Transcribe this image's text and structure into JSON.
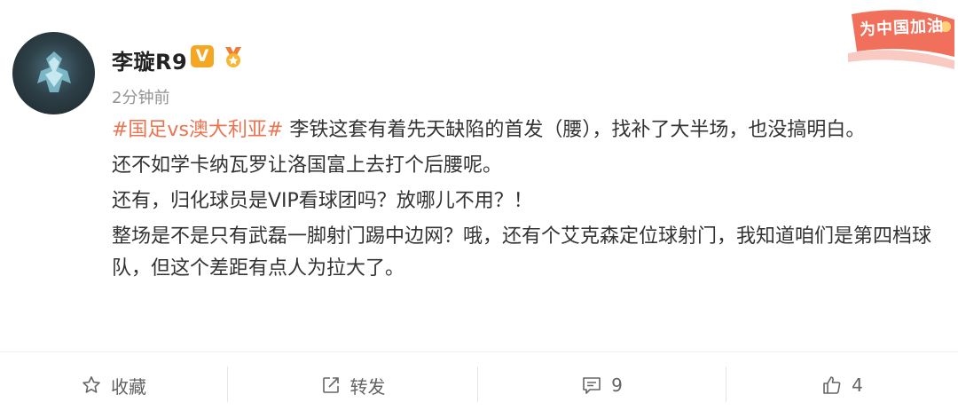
{
  "user": {
    "name": "李璇R9",
    "verified_badge": "V",
    "timestamp": "2分钟前"
  },
  "decoration": {
    "text": "为中国加油"
  },
  "post": {
    "hashtag": "#国足vs澳大利亚#",
    "lines": [
      " 李铁这套有着先天缺陷的首发（腰），找补了大半场，也没搞明白。",
      "还不如学卡纳瓦罗让洛国富上去打个后腰呢。",
      "还有，归化球员是VIP看球团吗？放哪儿不用？！",
      "整场是不是只有武磊一脚射门踢中边网？哦，还有个艾克森定位球射门，我知道咱们是第四档球队，但这个差距有点人为拉大了。"
    ]
  },
  "actions": {
    "favorite_label": "收藏",
    "repost_label": "转发",
    "comment_count": "9",
    "like_count": "4"
  },
  "colors": {
    "accent": "#eb7350",
    "vip": "#f5a623"
  }
}
